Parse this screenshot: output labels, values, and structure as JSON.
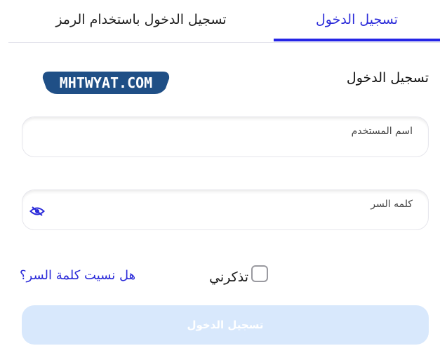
{
  "tabs": {
    "login": "تسجيل الدخول",
    "code_login": "تسجيل الدخول باستخدام الرمز"
  },
  "form": {
    "title": "تسجيل الدخول",
    "username_label": "اسم المستخدم",
    "username_value": "",
    "password_label": "كلمه السر",
    "password_value": "",
    "remember_label": "تذكرني",
    "remember_checked": false,
    "forgot_link": "هل نسيت كلمة السر؟",
    "submit_label": "تسجيل الدخول"
  },
  "logo": {
    "text": "MHTWYAT.COM"
  },
  "icons": {
    "password_toggle": "eye-slash-icon"
  },
  "colors": {
    "accent": "#2b2bd9",
    "tab_underline": "#2525e6",
    "logo_bg": "#1f4f86",
    "submit_bg": "#d8e8fc"
  }
}
